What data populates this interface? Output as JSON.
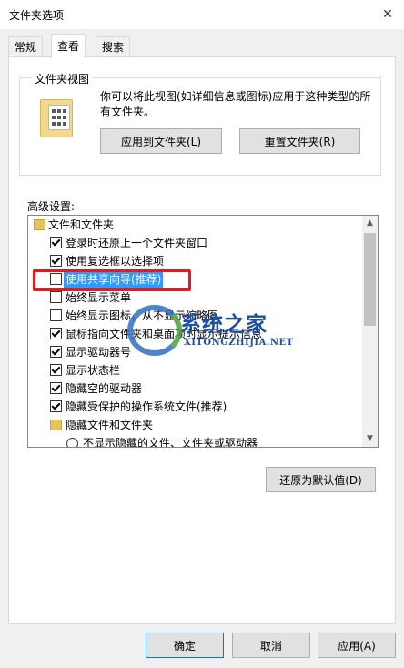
{
  "window": {
    "title": "文件夹选项",
    "close_glyph": "✕"
  },
  "tabs": [
    {
      "label": "常规",
      "active": false
    },
    {
      "label": "查看",
      "active": true
    },
    {
      "label": "搜索",
      "active": false
    }
  ],
  "folder_views": {
    "group_label": "文件夹视图",
    "icon": "folder-grid-icon",
    "description": "你可以将此视图(如详细信息或图标)应用于这种类型的所有文件夹。",
    "apply_button": "应用到文件夹(L)",
    "reset_button": "重置文件夹(R)"
  },
  "advanced": {
    "label": "高级设置:",
    "items": [
      {
        "kind": "folder",
        "label": "文件和文件夹"
      },
      {
        "kind": "checkbox",
        "checked": true,
        "label": "登录时还原上一个文件夹窗口"
      },
      {
        "kind": "checkbox",
        "checked": true,
        "label": "使用复选框以选择项"
      },
      {
        "kind": "checkbox",
        "checked": false,
        "label": "使用共享向导(推荐)",
        "selected": true
      },
      {
        "kind": "checkbox",
        "checked": false,
        "label": "始终显示菜单"
      },
      {
        "kind": "checkbox",
        "checked": false,
        "label": "始终显示图标，从不显示缩略图"
      },
      {
        "kind": "checkbox",
        "checked": true,
        "label": "鼠标指向文件夹和桌面项时显示提示信息"
      },
      {
        "kind": "checkbox",
        "checked": true,
        "label": "显示驱动器号"
      },
      {
        "kind": "checkbox",
        "checked": true,
        "label": "显示状态栏"
      },
      {
        "kind": "checkbox",
        "checked": true,
        "label": "隐藏空的驱动器"
      },
      {
        "kind": "checkbox",
        "checked": true,
        "label": "隐藏受保护的操作系统文件(推荐)"
      },
      {
        "kind": "folder",
        "label": "隐藏文件和文件夹"
      },
      {
        "kind": "radio",
        "checked": false,
        "label": "不显示隐藏的文件、文件夹或驱动器"
      }
    ],
    "restore_button": "还原为默认值(D)"
  },
  "watermark": {
    "cn": "系统之家",
    "en": "XITONGZHIJIA.NET"
  },
  "footer": {
    "ok": "确定",
    "cancel": "取消",
    "apply": "应用(A)"
  },
  "colors": {
    "selection": "#3399ff",
    "highlight_box": "#e21b1b",
    "focus": "#0078d7"
  }
}
